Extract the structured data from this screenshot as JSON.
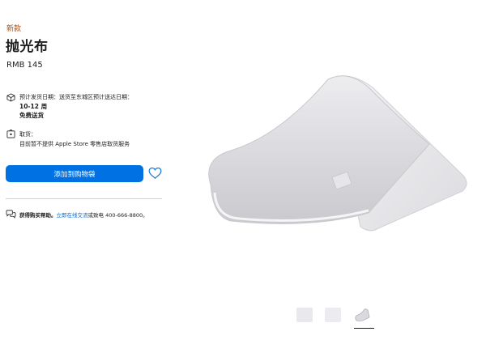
{
  "product": {
    "badge": "新款",
    "title": "抛光布",
    "price": "RMB 145"
  },
  "shipping": {
    "line1_prefix": "预计发货日期：送货至",
    "region_link": "东城区",
    "line1_suffix": "预计送达日期：",
    "window": "10-12 周",
    "free_delivery": "免费送货"
  },
  "pickup": {
    "label": "取货：",
    "detail": "目前暂不提供 Apple Store 零售店取货服务"
  },
  "actions": {
    "add_to_bag": "添加到购物袋"
  },
  "help": {
    "prefix": "获得购买帮助。",
    "chat_link": "立即在线交流",
    "suffix": "或致电 400-666-8800。"
  },
  "colors": {
    "accent": "#0071e3",
    "badge": "#bf4800",
    "link": "#0066cc"
  },
  "icons": {
    "shipping": "box-icon",
    "pickup": "store-icon",
    "favorite": "heart-icon",
    "help": "chat-bubbles-icon"
  }
}
